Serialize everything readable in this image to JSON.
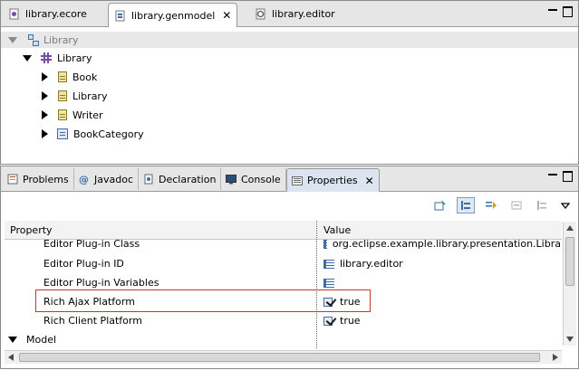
{
  "editor": {
    "tabs": [
      {
        "label": "library.ecore",
        "icon": "ecore-file-icon"
      },
      {
        "label": "library.genmodel",
        "icon": "genmodel-file-icon",
        "active": true
      },
      {
        "label": "library.editor",
        "icon": "plugin-editor-icon"
      }
    ],
    "tree": {
      "root": "Library",
      "package": "Library",
      "children": [
        "Book",
        "Library",
        "Writer",
        "BookCategory"
      ]
    }
  },
  "views": {
    "tabs": [
      {
        "label": "Problems",
        "icon": "problems-icon"
      },
      {
        "label": "Javadoc",
        "icon": "at-icon"
      },
      {
        "label": "Declaration",
        "icon": "declaration-icon"
      },
      {
        "label": "Console",
        "icon": "console-icon"
      },
      {
        "label": "Properties",
        "icon": "properties-icon",
        "active": true
      }
    ],
    "table": {
      "headers": [
        "Property",
        "Value"
      ],
      "rows": [
        {
          "property": "Editor Plug-in Class",
          "value": "org.eclipse.example.library.presentation.Libra",
          "icon": "text-lines-icon"
        },
        {
          "property": "Editor Plug-in ID",
          "value": "library.editor",
          "icon": "text-lines-icon"
        },
        {
          "property": "Editor Plug-in Variables",
          "value": "",
          "icon": "text-lines-icon"
        },
        {
          "property": "Rich Ajax Platform",
          "value": "true",
          "icon": "boolean-check-icon"
        },
        {
          "property": "Rich Client Platform",
          "value": "true",
          "icon": "boolean-check-icon"
        }
      ],
      "group": "Model"
    }
  }
}
